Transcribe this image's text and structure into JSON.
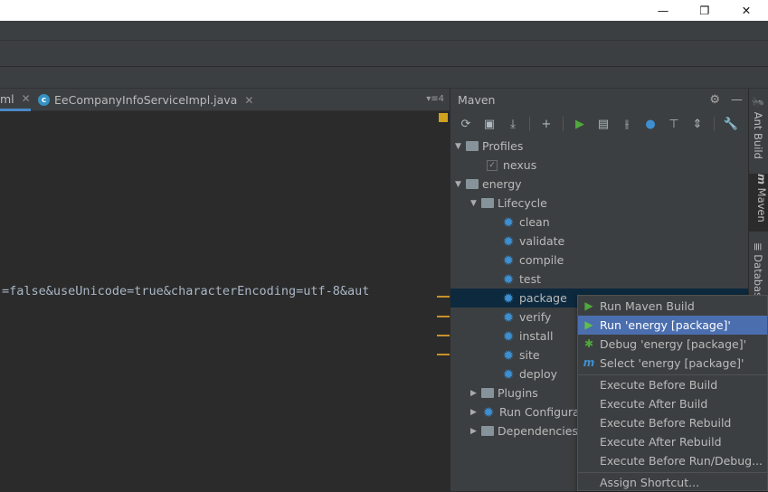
{
  "window": {
    "minimize": "—",
    "restore": "❐",
    "close": "✕"
  },
  "tabs": [
    {
      "label": "ml",
      "close": "✕"
    },
    {
      "label": "EeCompanyInfoServiceImpl.java",
      "close": "✕"
    }
  ],
  "tab_menu": "▾≡4",
  "editor": {
    "code": "=false&useUnicode=true&characterEncoding=utf-8&aut"
  },
  "maven": {
    "title": "Maven",
    "tree": {
      "profiles": "Profiles",
      "nexus": "nexus",
      "energy": "energy",
      "lifecycle": "Lifecycle",
      "phases": [
        "clean",
        "validate",
        "compile",
        "test",
        "package",
        "verify",
        "install",
        "site",
        "deploy"
      ],
      "plugins": "Plugins",
      "run_configs": "Run Configura",
      "dependencies": "Dependencies"
    }
  },
  "side_tabs": {
    "ant": "Ant Build",
    "maven": "Maven",
    "database": "Databas"
  },
  "context_menu": {
    "items": [
      {
        "label": "Run Maven Build",
        "icon": "run-icon"
      },
      {
        "label": "Run 'energy [package]'",
        "icon": "run-icon"
      },
      {
        "label": "Debug 'energy [package]'",
        "icon": "debug-icon"
      },
      {
        "label": "Select 'energy [package]'",
        "icon": "maven-icon"
      },
      {
        "label": "Execute Before Build"
      },
      {
        "label": "Execute After Build"
      },
      {
        "label": "Execute Before Rebuild"
      },
      {
        "label": "Execute After Rebuild"
      },
      {
        "label": "Execute Before Run/Debug..."
      },
      {
        "label": "Assign Shortcut..."
      }
    ]
  }
}
